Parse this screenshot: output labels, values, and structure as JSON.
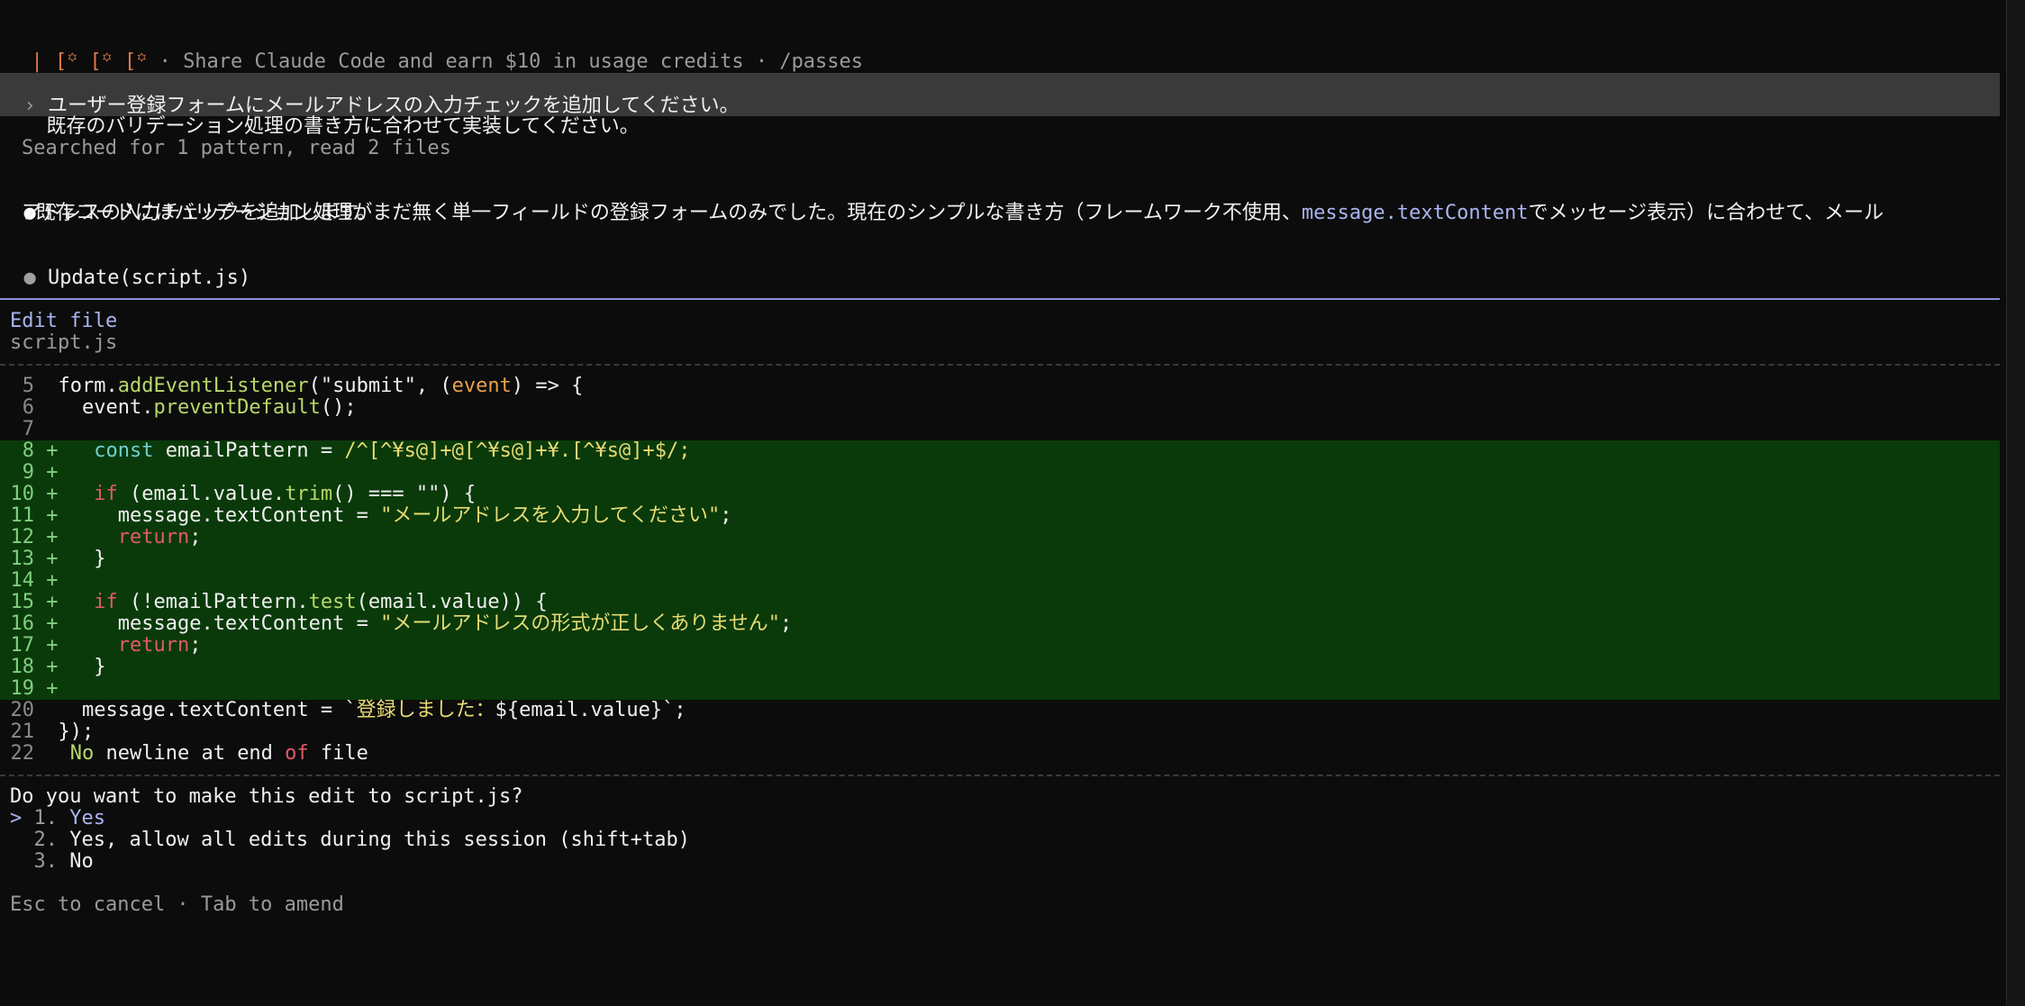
{
  "banner": {
    "icons": "| [꙳ [꙳ [꙳",
    "text": " · Share Claude Code and earn $10 in usage credits · /passes"
  },
  "prompt": {
    "line1": "ユーザー登録フォームにメールアドレスの入力チェックを追加してください。",
    "line2": "既存のバリデーション処理の書き方に合わせて実装してください。"
  },
  "searched": "Searched for 1 pattern, read 2 files",
  "assistant": {
    "line1_a": "既存コードにはバリデーション処理がまだ無く単一フィールドの登録フォームのみでした。現在のシンプルな書き方（フレームワーク不使用、",
    "line1_code": "message.textContent",
    "line1_b": "でメッセージ表示）に合わせて、メール",
    "line2": "アドレスの入力チェックを追加します。"
  },
  "tool": {
    "label": "Update(script.js)"
  },
  "edit": {
    "title": "Edit file",
    "filename": "script.js"
  },
  "code": {
    "l5": [
      "5",
      "form.",
      "addEventListener",
      "(\"submit\", (",
      "event",
      ") => {"
    ],
    "l6": [
      "6",
      "  event.",
      "preventDefault",
      "();"
    ],
    "l7": [
      "7"
    ],
    "l8": [
      "8",
      "+",
      "  ",
      "const",
      " emailPattern = ",
      "/^[^¥s@]+@[^¥s@]+¥.[^¥s@]+$/;"
    ],
    "l9": [
      "9",
      "+"
    ],
    "l10": [
      "10",
      "+",
      "  ",
      "if",
      " (email.value.",
      "trim",
      "() === \"\") {"
    ],
    "l11": [
      "11",
      "+",
      "    message.textContent = ",
      "\"メールアドレスを入力してください\"",
      ";"
    ],
    "l12": [
      "12",
      "+",
      "    ",
      "return",
      ";"
    ],
    "l13": [
      "13",
      "+",
      "  }"
    ],
    "l14": [
      "14",
      "+"
    ],
    "l15": [
      "15",
      "+",
      "  ",
      "if",
      " (!emailPattern.",
      "test",
      "(email.value)) {"
    ],
    "l16": [
      "16",
      "+",
      "    message.textContent = ",
      "\"メールアドレスの形式が正しくありません\"",
      ";"
    ],
    "l17": [
      "17",
      "+",
      "    ",
      "return",
      ";"
    ],
    "l18": [
      "18",
      "+",
      "  }"
    ],
    "l19": [
      "19",
      "+"
    ],
    "l20": [
      "20",
      "  message.textContent = `",
      "登録しました：",
      "${email.value}",
      "`;"
    ],
    "l21": [
      "21",
      "});"
    ],
    "l22": [
      "22",
      " ",
      "No",
      " newline at end ",
      "of",
      " file"
    ]
  },
  "question": "Do you want to make this edit to script.js?",
  "options": [
    {
      "marker": "> ",
      "num": "1.",
      "label": "Yes"
    },
    {
      "marker": "  ",
      "num": "2.",
      "label": "Yes, allow all edits during this session (shift+tab)"
    },
    {
      "marker": "  ",
      "num": "3.",
      "label": "No"
    }
  ],
  "footer": "Esc to cancel · Tab to amend"
}
